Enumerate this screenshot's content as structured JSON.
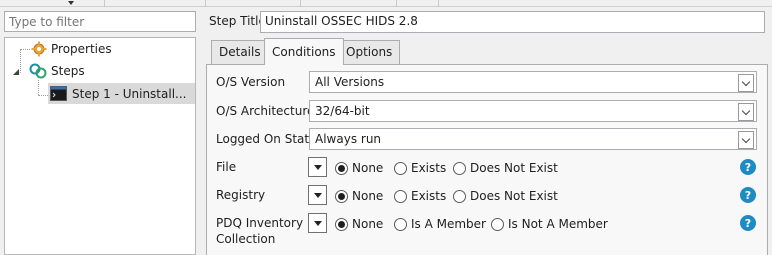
{
  "filter": {
    "placeholder": "Type to filter"
  },
  "tree": {
    "items": [
      {
        "label": "Properties",
        "icon": "gear-icon"
      },
      {
        "label": "Steps",
        "icon": "steps-icon",
        "expanded": true
      },
      {
        "label": "Step 1 - Uninstall...",
        "icon": "console-icon",
        "selected": true
      }
    ]
  },
  "step_title": {
    "label": "Step Title",
    "value": "Uninstall OSSEC HIDS 2.8"
  },
  "tabs": [
    {
      "label": "Details",
      "active": false
    },
    {
      "label": "Conditions",
      "active": true
    },
    {
      "label": "Options",
      "active": false
    }
  ],
  "conditions": {
    "os_version": {
      "label": "O/S Version",
      "value": "All Versions"
    },
    "os_arch": {
      "label": "O/S Architecture",
      "value": "32/64-bit"
    },
    "logged_on": {
      "label": "Logged On State",
      "value": "Always run"
    },
    "file": {
      "label": "File",
      "options": [
        "None",
        "Exists",
        "Does Not Exist"
      ],
      "selected": "None"
    },
    "registry": {
      "label": "Registry",
      "options": [
        "None",
        "Exists",
        "Does Not Exist"
      ],
      "selected": "None"
    },
    "pdq": {
      "label_line1": "PDQ Inventory",
      "label_line2": "Collection",
      "options": [
        "None",
        "Is A Member",
        "Is Not A Member"
      ],
      "selected": "None"
    }
  },
  "help_glyph": "?",
  "colors": {
    "help_icon": "#1e8bc3",
    "selection": "#d9d9d9"
  }
}
